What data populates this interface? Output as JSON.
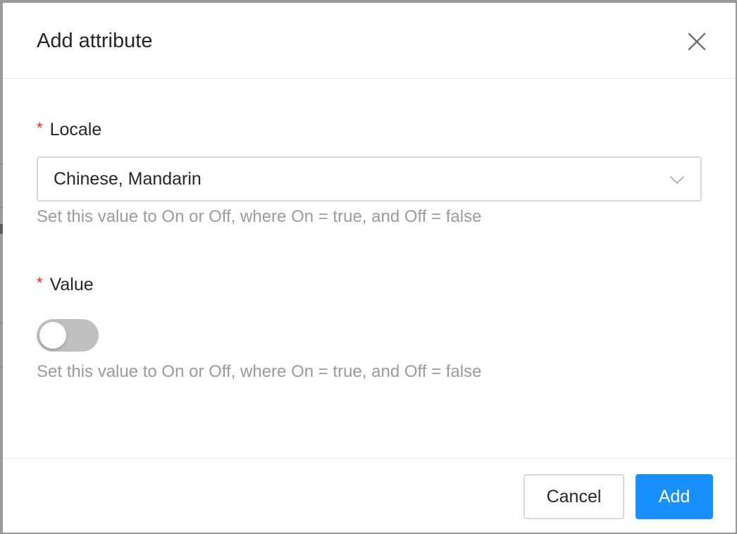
{
  "modal": {
    "title": "Add attribute",
    "close_icon": "close-icon"
  },
  "locale_field": {
    "required_mark": "*",
    "label": "Locale",
    "selected_value": "Chinese, Mandarin",
    "arrow_icon": "chevron-down-icon",
    "help": "Set this value to On or Off, where On = true, and Off = false"
  },
  "value_field": {
    "required_mark": "*",
    "label": "Value",
    "toggle_on": false,
    "help": "Set this value to On or Off, where On = true, and Off = false"
  },
  "footer": {
    "cancel_label": "Cancel",
    "add_label": "Add"
  },
  "colors": {
    "primary": "#1890ff",
    "required": "#f5222d",
    "help_text": "#9b9b9b",
    "switch_off": "#bfbfbf"
  }
}
